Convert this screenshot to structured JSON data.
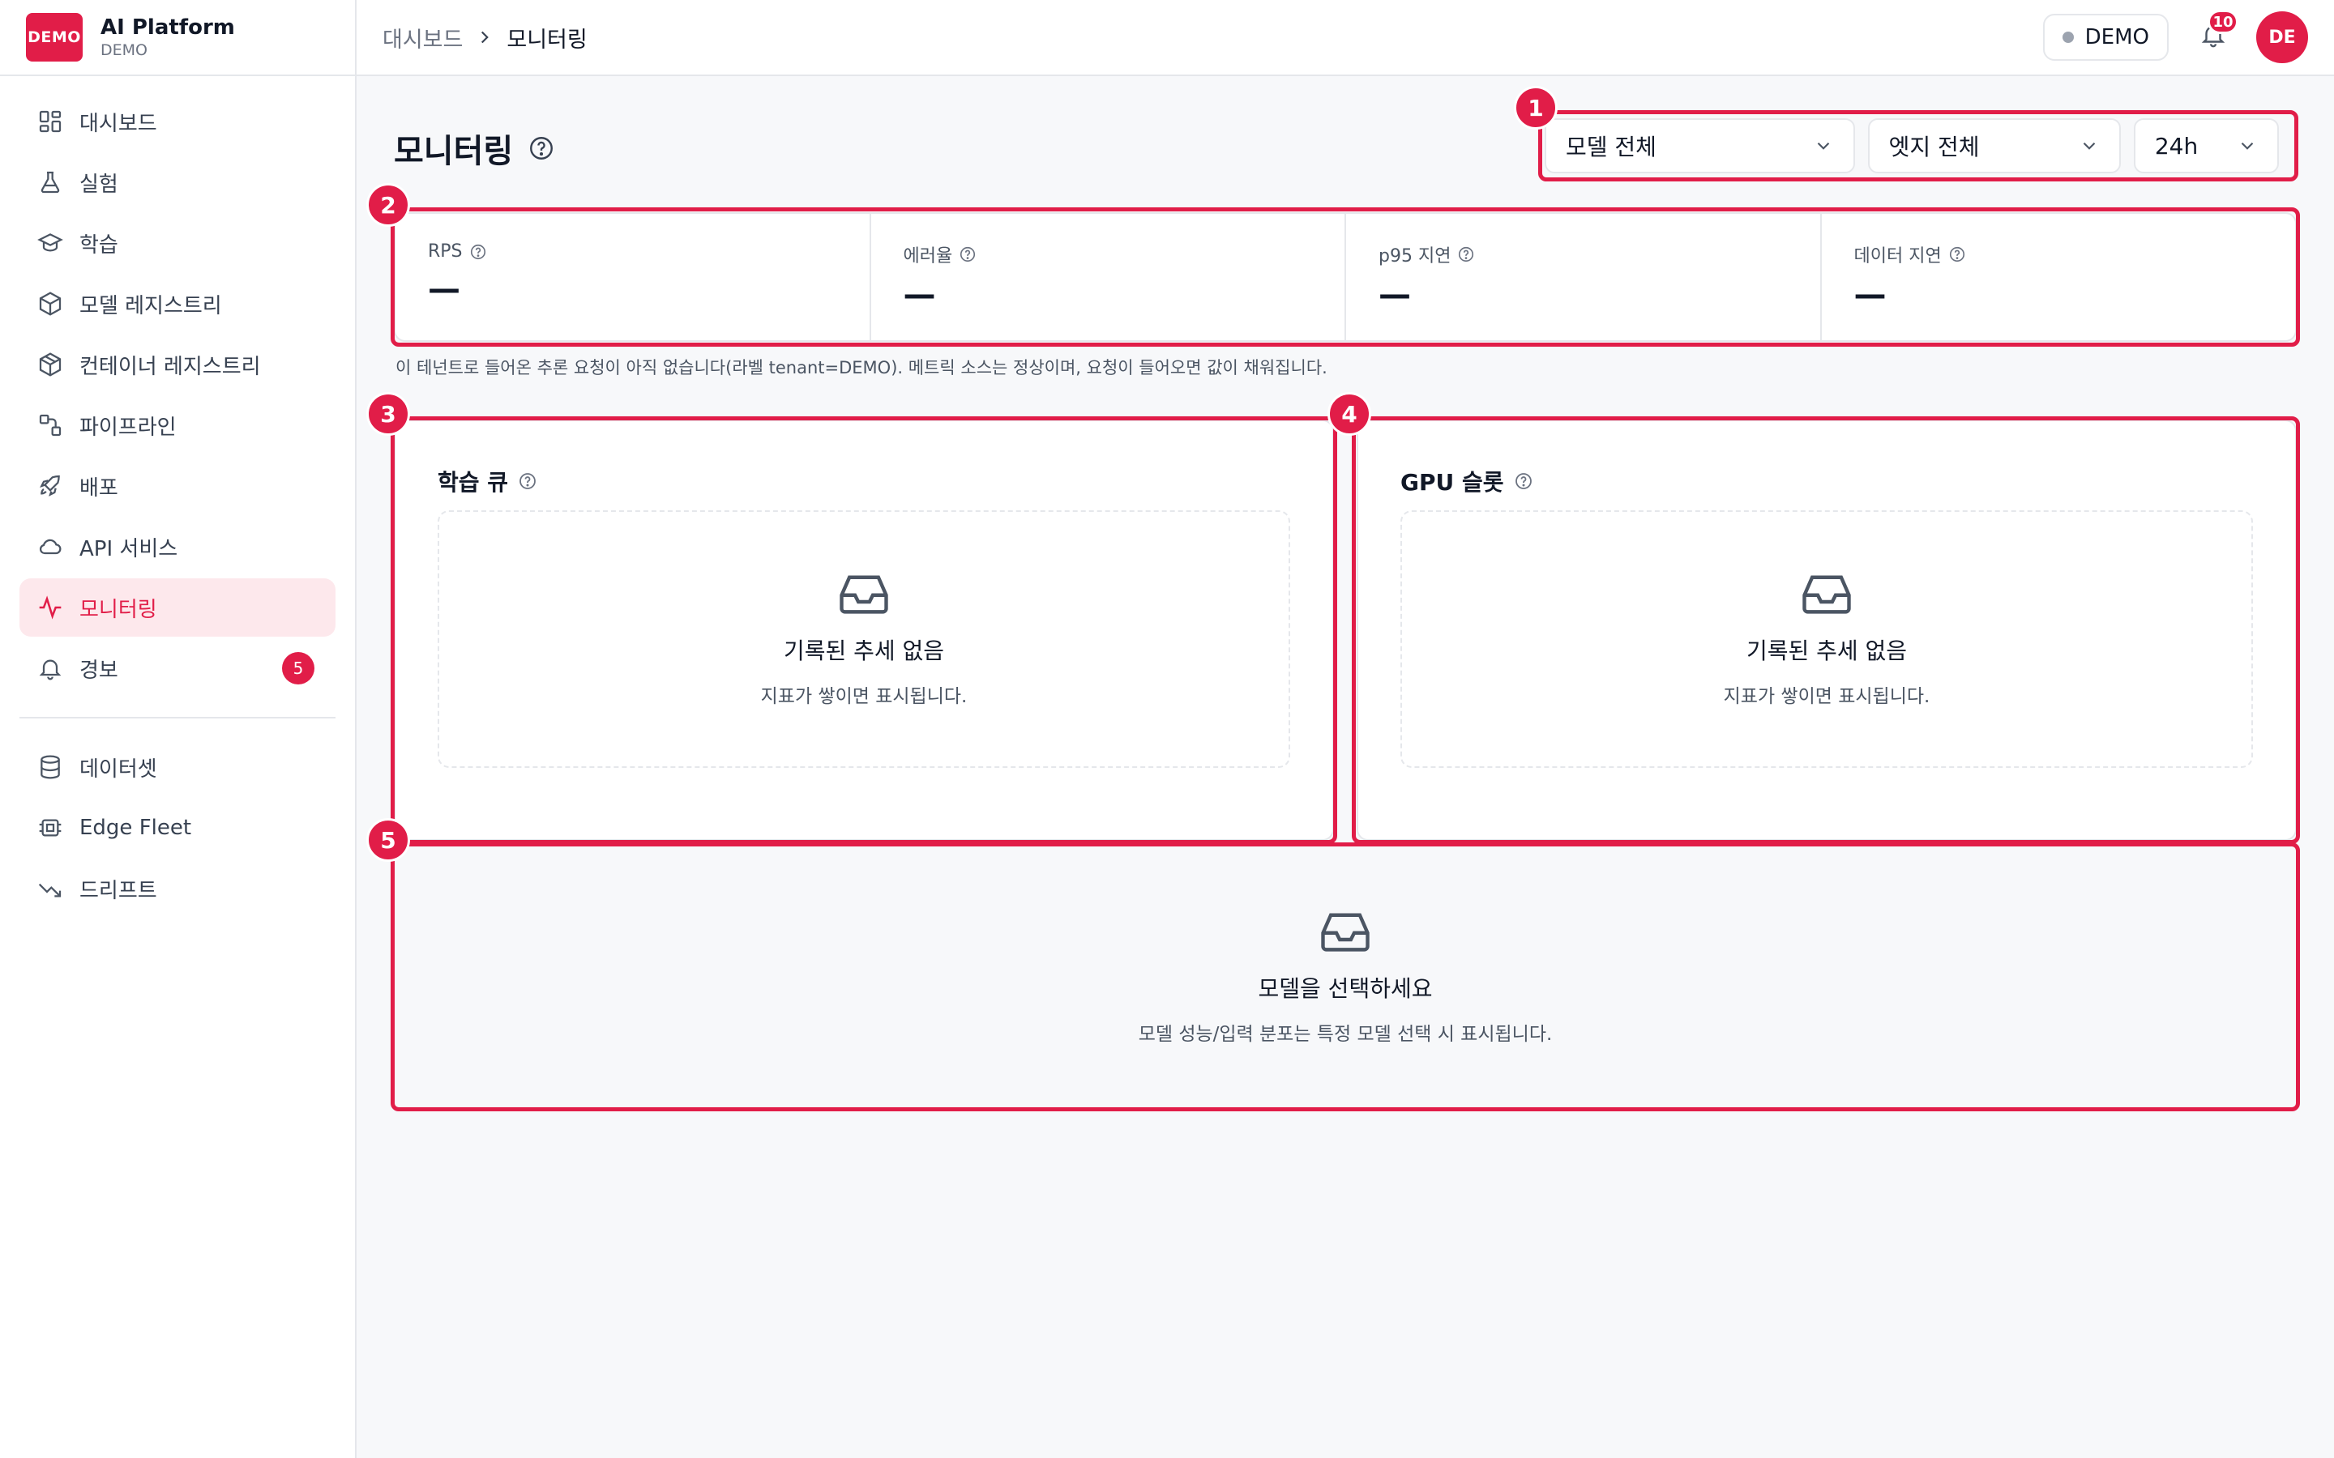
{
  "brand": {
    "logo_text": "DEMO",
    "title": "AI Platform",
    "subtitle": "DEMO"
  },
  "sidebar": {
    "items": [
      {
        "label": "대시보드",
        "icon": "dashboard-icon"
      },
      {
        "label": "실험",
        "icon": "flask-icon"
      },
      {
        "label": "학습",
        "icon": "graduation-cap-icon"
      },
      {
        "label": "모델 레지스트리",
        "icon": "box-icon"
      },
      {
        "label": "컨테이너 레지스트리",
        "icon": "package-icon"
      },
      {
        "label": "파이프라인",
        "icon": "workflow-icon"
      },
      {
        "label": "배포",
        "icon": "rocket-icon"
      },
      {
        "label": "API 서비스",
        "icon": "cloud-icon"
      },
      {
        "label": "모니터링",
        "icon": "activity-icon",
        "active": true
      },
      {
        "label": "경보",
        "icon": "bell-icon",
        "badge": "5"
      }
    ],
    "secondary_items": [
      {
        "label": "데이터셋",
        "icon": "database-icon"
      },
      {
        "label": "Edge Fleet",
        "icon": "edge-device-icon"
      },
      {
        "label": "드리프트",
        "icon": "trending-down-icon"
      }
    ]
  },
  "header": {
    "breadcrumb_parent": "대시보드",
    "breadcrumb_current": "모니터링",
    "tenant": "DEMO",
    "notification_count": "10",
    "avatar_initials": "DE"
  },
  "page": {
    "title": "모니터링",
    "filters": {
      "model": "모델 전체",
      "edge": "엣지 전체",
      "range": "24h"
    },
    "kpis": [
      {
        "label": "RPS",
        "value": "—"
      },
      {
        "label": "에러율",
        "value": "—"
      },
      {
        "label": "p95 지연",
        "value": "—"
      },
      {
        "label": "데이터 지연",
        "value": "—"
      }
    ],
    "note": "이 테넌트로 들어온 추론 요청이 아직 없습니다(라벨 tenant=DEMO). 메트릭 소스는 정상이며, 요청이 들어오면 값이 채워집니다.",
    "training_queue": {
      "title": "학습 큐",
      "empty_title": "기록된 추세 없음",
      "empty_sub": "지표가 쌓이면 표시됩니다."
    },
    "gpu_slots": {
      "title": "GPU 슬롯",
      "empty_title": "기록된 추세 없음",
      "empty_sub": "지표가 쌓이면 표시됩니다."
    },
    "model_perf": {
      "empty_title": "모델을 선택하세요",
      "empty_sub": "모델 성능/입력 분포는 특정 모델 선택 시 표시됩니다."
    }
  },
  "annotations": [
    "1",
    "2",
    "3",
    "4",
    "5"
  ],
  "colors": {
    "accent": "#e11d48",
    "border": "#e5e7eb",
    "background": "#f7f8fa"
  }
}
